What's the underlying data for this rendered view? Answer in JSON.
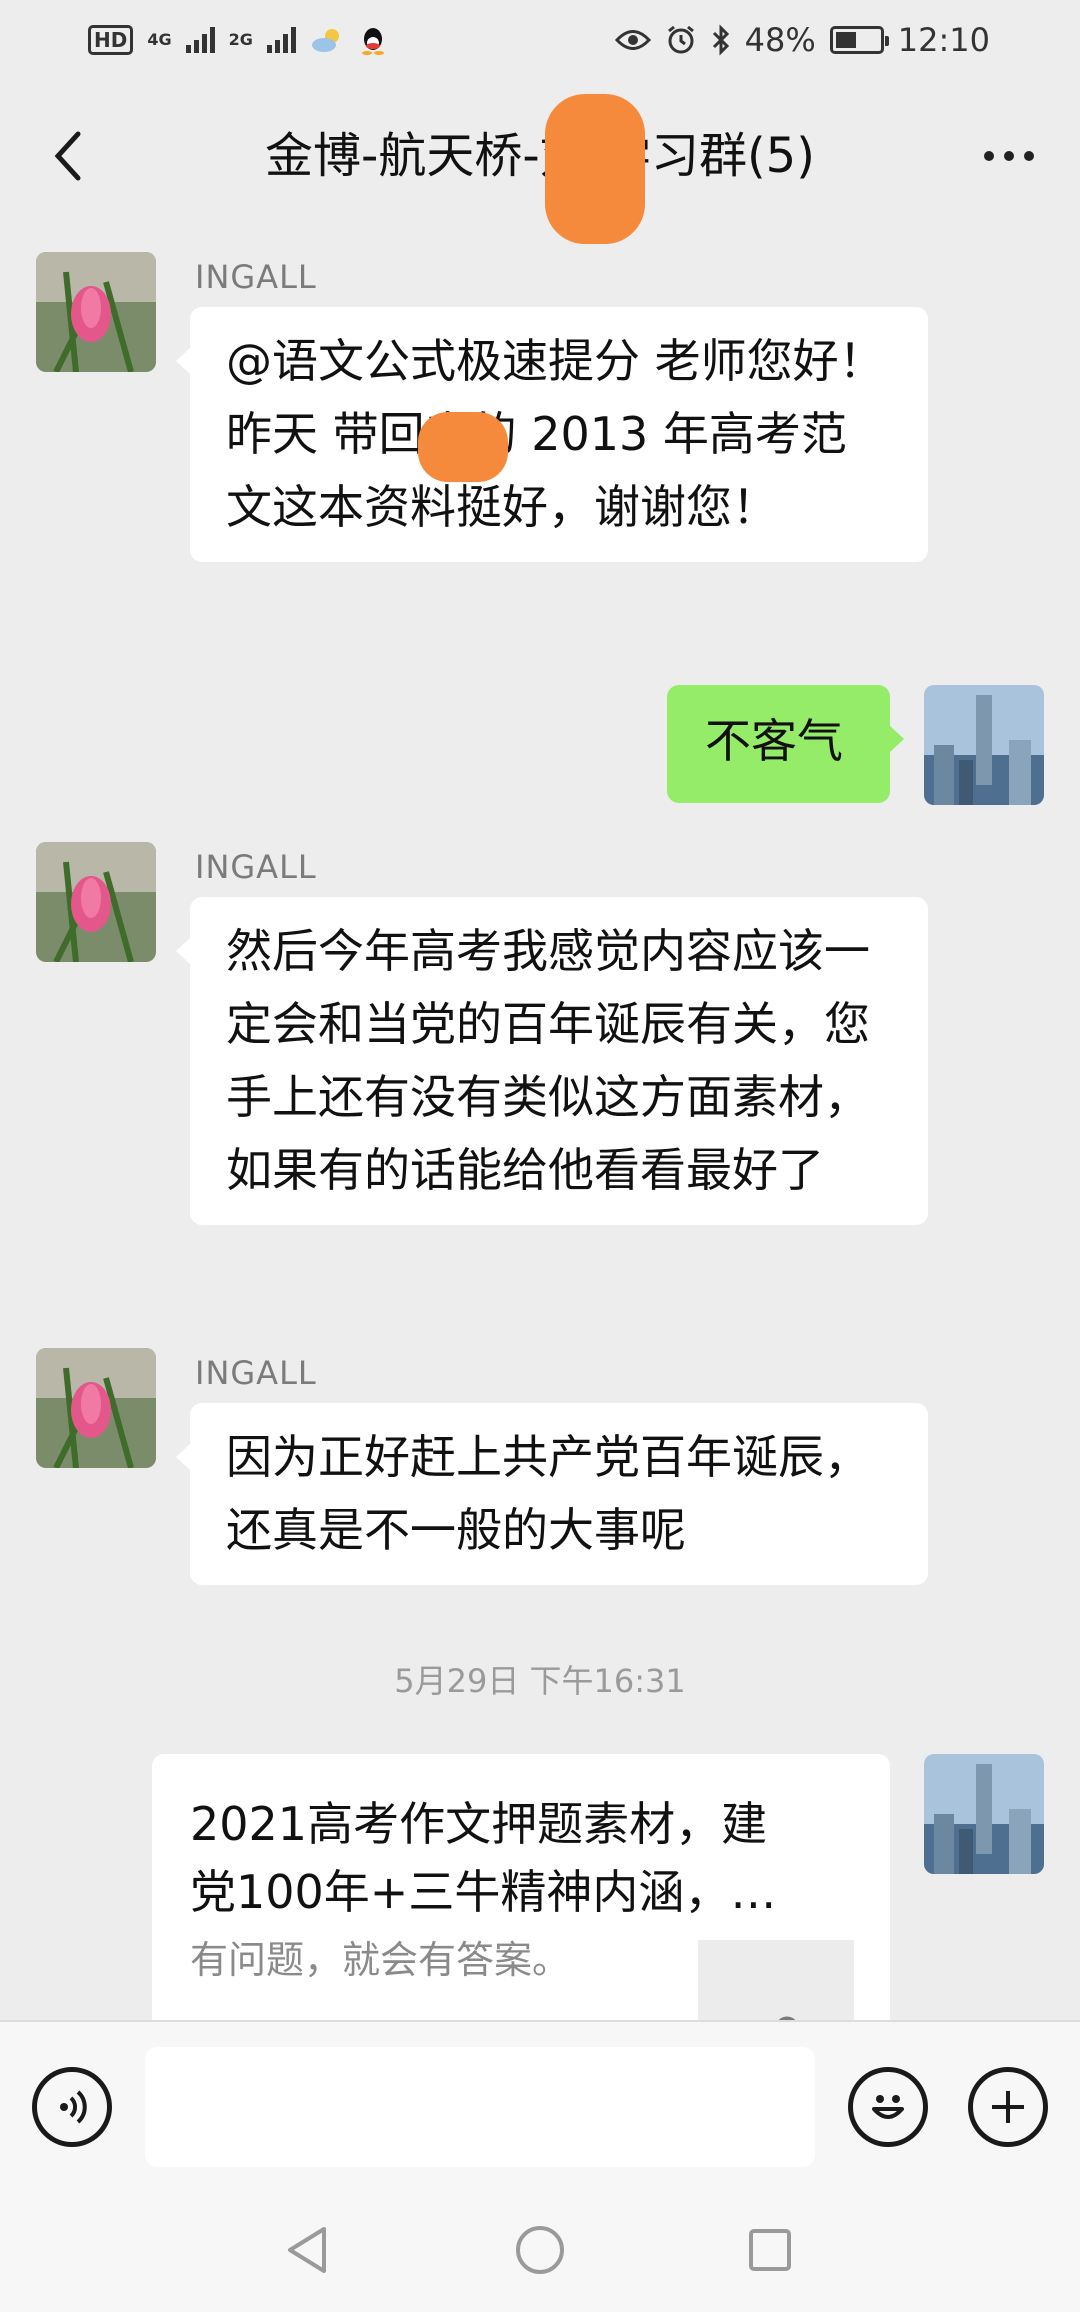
{
  "status_bar": {
    "hd": "HD",
    "net1": "4G",
    "net2": "2G",
    "battery": "48%",
    "battery_level": 0.48,
    "time": "12:10"
  },
  "header": {
    "title": "金博-航天桥-刘 学习群(5)",
    "back_icon": "chevron-left-icon",
    "more_icon": "more-dots-icon"
  },
  "messages": [
    {
      "sender": "INGALL",
      "text": "@语文公式极速提分  老师您好！昨天 带回来的 2013 年高考范文这本资料挺好，谢谢您！"
    },
    {
      "sender": "",
      "text": "不客气"
    },
    {
      "sender": "INGALL",
      "text": "然后今年高考我感觉内容应该一定会和当党的百年诞辰有关，您手上还有没有类似这方面素材，如果有的话能给他看看最好了"
    },
    {
      "sender": "INGALL",
      "text": "因为正好赶上共产党百年诞辰，还真是不一般的大事呢"
    }
  ],
  "timestamp": "5月29日 下午16:31",
  "link_card": {
    "title": "2021高考作文押题素材，建党100年+三牛精神内涵，…",
    "description": "有问题，就会有答案。",
    "thumb_icon": "link-icon"
  },
  "input_bar": {
    "voice_icon": "voice-icon",
    "emoji_icon": "emoji-icon",
    "plus_icon": "plus-icon"
  },
  "nav_bar": {
    "back": "nav-back-icon",
    "home": "nav-home-icon",
    "recent": "nav-recent-icon"
  },
  "colors": {
    "background": "#ededed",
    "my_bubble": "#95ec69",
    "their_bubble": "#ffffff",
    "redaction": "#f58a3c"
  }
}
